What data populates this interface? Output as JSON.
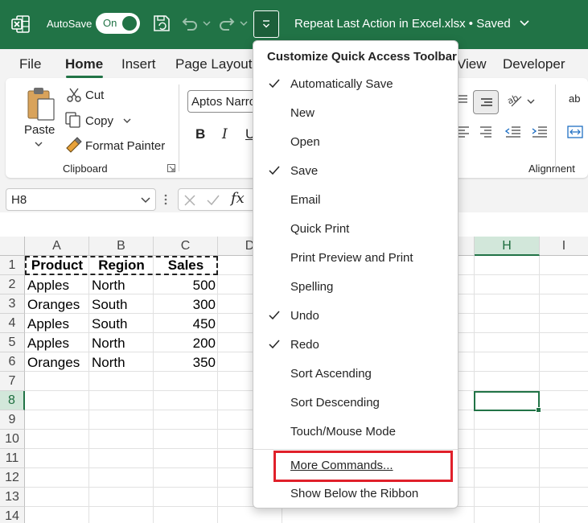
{
  "titlebar": {
    "autosave_label": "AutoSave",
    "toggle_label": "On",
    "filename": "Repeat Last Action in Excel.xlsx • Saved",
    "brand_color": "#217346"
  },
  "tabs": [
    "File",
    "Home",
    "Insert",
    "Page Layout",
    "View",
    "Developer"
  ],
  "ribbon": {
    "paste_label": "Paste",
    "cut_label": "Cut",
    "copy_label": "Copy",
    "format_painter_label": "Format Painter",
    "clipboard_group": "Clipboard",
    "font_name": "Aptos Narro",
    "bold": "B",
    "italic": "I",
    "underline": "U",
    "alignment_group": "Alignment",
    "wrap_label": "ab"
  },
  "formula_bar": {
    "name_box": "H8",
    "fx": "fx"
  },
  "grid": {
    "columns": [
      "A",
      "B",
      "C",
      "D",
      "H",
      "I"
    ],
    "rows": [
      "1",
      "2",
      "3",
      "4",
      "5",
      "6",
      "7",
      "8",
      "9",
      "10",
      "11",
      "12",
      "13",
      "14"
    ],
    "headers": [
      "Product",
      "Region",
      "Sales"
    ],
    "data": [
      [
        "Apples",
        "North",
        "500"
      ],
      [
        "Oranges",
        "South",
        "300"
      ],
      [
        "Apples",
        "South",
        "450"
      ],
      [
        "Apples",
        "North",
        "200"
      ],
      [
        "Oranges",
        "North",
        "350"
      ]
    ],
    "selected_column": "H",
    "selected_row": "8"
  },
  "menu": {
    "title": "Customize Quick Access Toolbar",
    "items": [
      {
        "label": "Automatically Save",
        "checked": true
      },
      {
        "label": "New",
        "checked": false
      },
      {
        "label": "Open",
        "checked": false
      },
      {
        "label": "Save",
        "checked": true
      },
      {
        "label": "Email",
        "checked": false
      },
      {
        "label": "Quick Print",
        "checked": false
      },
      {
        "label": "Print Preview and Print",
        "checked": false
      },
      {
        "label": "Spelling",
        "checked": false
      },
      {
        "label": "Undo",
        "checked": true
      },
      {
        "label": "Redo",
        "checked": true
      },
      {
        "label": "Sort Ascending",
        "checked": false
      },
      {
        "label": "Sort Descending",
        "checked": false
      },
      {
        "label": "Touch/Mouse Mode",
        "checked": false
      }
    ],
    "more_commands": "More Commands...",
    "show_below": "Show Below the Ribbon",
    "highlight_color": "#e0202a"
  }
}
